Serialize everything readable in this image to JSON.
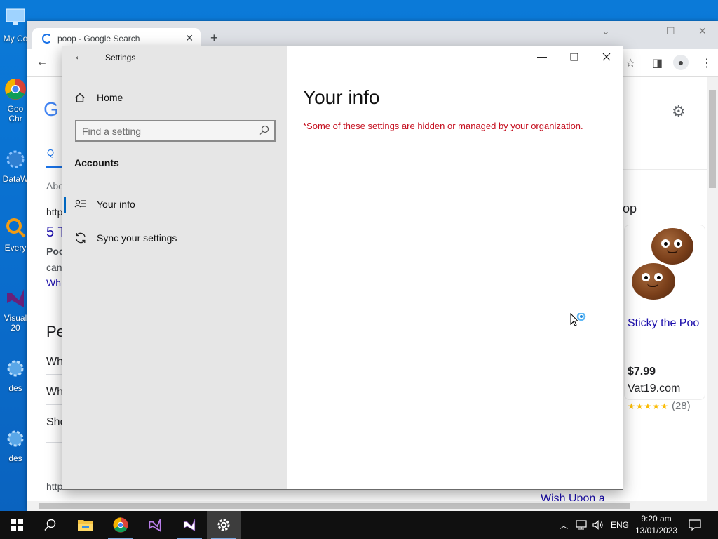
{
  "desktop": {
    "icons": [
      {
        "label": "My Co"
      },
      {
        "label": "Goo"
      },
      {
        "label": "Chr"
      },
      {
        "label": "DataW"
      },
      {
        "label": "Every"
      },
      {
        "label": "Visual"
      },
      {
        "label": "20"
      },
      {
        "label": "des"
      },
      {
        "label": "des"
      }
    ]
  },
  "chrome": {
    "tab_title": "poop - Google Search",
    "new_tab": "+",
    "page_fragments": {
      "g": "G",
      "search_tab_icon": "Q",
      "about": "Abo",
      "http1": "http",
      "five": "5 T",
      "poo": "Poo",
      "can": "can",
      "wh1": "Wh",
      "pe": "Pe",
      "wh2": "Wh",
      "wh3": "Wh",
      "sho": "Sho",
      "http2": "http",
      "op": "op",
      "wish": "Wish Upon a"
    },
    "shopping": {
      "title": "Sticky the Poo",
      "price": "$7.99",
      "seller": "Vat19.com",
      "stars": "★★★★★",
      "count": "(28)"
    }
  },
  "settings": {
    "app_title": "Settings",
    "home_label": "Home",
    "search_placeholder": "Find a setting",
    "section_header": "Accounts",
    "nav": [
      {
        "label": "Your info",
        "icon": "contact-info-icon",
        "selected": true
      },
      {
        "label": "Sync your settings",
        "icon": "sync-icon",
        "selected": false
      }
    ],
    "page_title": "Your info",
    "managed_notice": "*Some of these settings are hidden or managed by your organization.",
    "accent_color": "#0067c0",
    "notice_color": "#c50f1f"
  },
  "taskbar": {
    "apps": [
      "start-icon",
      "search-icon",
      "file-explorer-icon",
      "chrome-icon",
      "visual-studio-icon",
      "visual-studio-active-icon",
      "settings-icon"
    ],
    "language": "ENG",
    "time": "9:20 am",
    "date": "13/01/2023"
  }
}
